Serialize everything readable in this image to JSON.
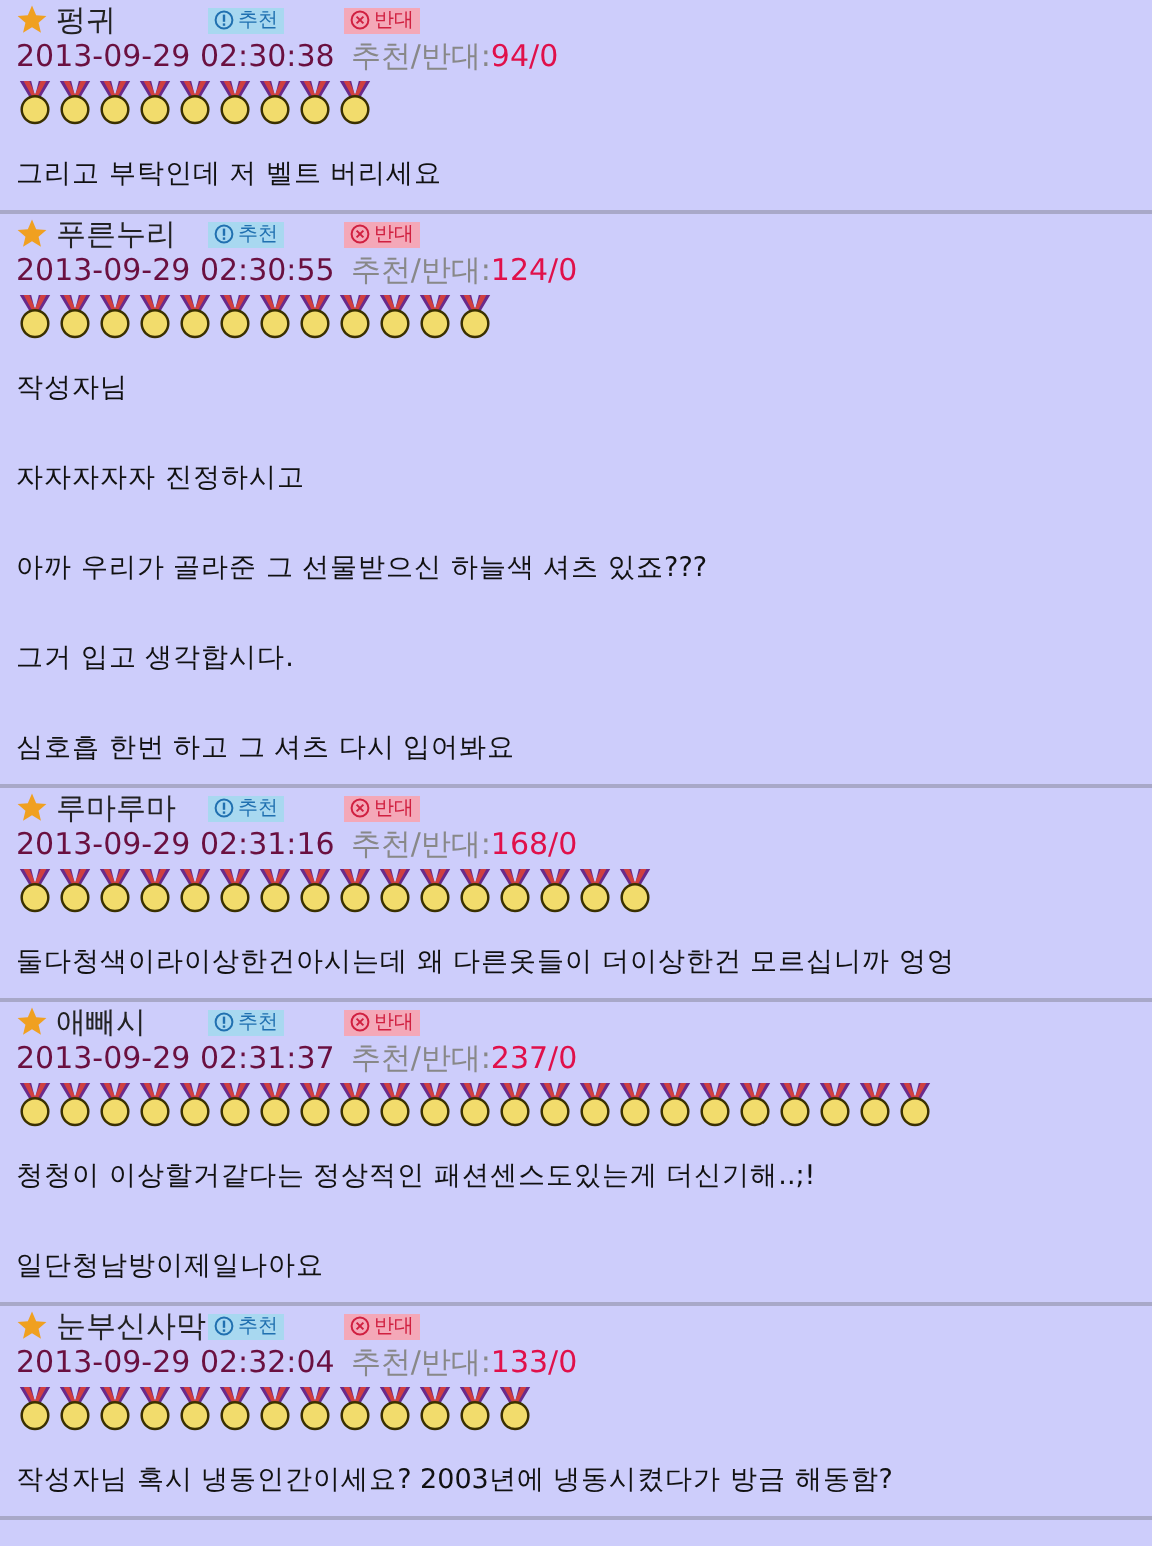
{
  "comments": [
    {
      "author": "펑귀",
      "recommend_label": "추천",
      "oppose_label": "반대",
      "datetime": "2013-09-29 02:30:38",
      "votes_label": "추천/반대:",
      "votes": "94/0",
      "medals": [
        {
          "kind": "medal"
        },
        {
          "kind": "medal"
        },
        {
          "kind": "medal"
        },
        {
          "kind": "medal"
        },
        {
          "kind": "medal"
        },
        {
          "kind": "medal"
        },
        {
          "kind": "medal"
        },
        {
          "kind": "medal"
        },
        {
          "kind": "medal"
        }
      ],
      "paragraphs": [
        "그리고 부탁인데 저 벨트 버리세요"
      ]
    },
    {
      "author": "푸른누리",
      "recommend_label": "추천",
      "oppose_label": "반대",
      "datetime": "2013-09-29 02:30:55",
      "votes_label": "추천/반대:",
      "votes": "124/0",
      "medals": [
        {
          "kind": "medal"
        },
        {
          "kind": "medal"
        },
        {
          "kind": "medal"
        },
        {
          "kind": "medal"
        },
        {
          "kind": "medal"
        },
        {
          "kind": "medal"
        },
        {
          "kind": "medal"
        },
        {
          "kind": "medal"
        },
        {
          "kind": "medal"
        },
        {
          "kind": "medal"
        },
        {
          "kind": "medal"
        },
        {
          "kind": "medal"
        }
      ],
      "paragraphs": [
        "작성자님",
        "자자자자자 진정하시고",
        "아까 우리가 골라준 그 선물받으신 하늘색 셔츠 있죠???",
        "그거 입고 생각합시다.",
        "심호흡 한번 하고 그 셔츠 다시 입어봐요"
      ]
    },
    {
      "author": "루마루마",
      "recommend_label": "추천",
      "oppose_label": "반대",
      "datetime": "2013-09-29 02:31:16",
      "votes_label": "추천/반대:",
      "votes": "168/0",
      "medals": [
        {
          "kind": "medal"
        },
        {
          "kind": "medal"
        },
        {
          "kind": "medal"
        },
        {
          "kind": "medal"
        },
        {
          "kind": "medal"
        },
        {
          "kind": "medal"
        },
        {
          "kind": "medal"
        },
        {
          "kind": "medal"
        },
        {
          "kind": "medal"
        },
        {
          "kind": "medal"
        },
        {
          "kind": "medal"
        },
        {
          "kind": "medal"
        },
        {
          "kind": "medal"
        },
        {
          "kind": "medal"
        },
        {
          "kind": "medal"
        },
        {
          "kind": "medal"
        }
      ],
      "paragraphs": [
        "둘다청색이라이상한건아시는데 왜 다른옷들이 더이상한건 모르십니까  엉엉"
      ]
    },
    {
      "author": "애빼시",
      "recommend_label": "추천",
      "oppose_label": "반대",
      "datetime": "2013-09-29 02:31:37",
      "votes_label": "추천/반대:",
      "votes": "237/0",
      "medals": [
        {
          "kind": "medal"
        },
        {
          "kind": "medal"
        },
        {
          "kind": "medal"
        },
        {
          "kind": "medal"
        },
        {
          "kind": "medal"
        },
        {
          "kind": "medal"
        },
        {
          "kind": "medal"
        },
        {
          "kind": "medal"
        },
        {
          "kind": "medal"
        },
        {
          "kind": "medal"
        },
        {
          "kind": "medal"
        },
        {
          "kind": "medal"
        },
        {
          "kind": "medal"
        },
        {
          "kind": "medal"
        },
        {
          "kind": "medal"
        },
        {
          "kind": "medal"
        },
        {
          "kind": "medal"
        },
        {
          "kind": "medal"
        },
        {
          "kind": "medal"
        },
        {
          "kind": "medal"
        },
        {
          "kind": "medal"
        },
        {
          "kind": "medal"
        },
        {
          "kind": "medal"
        }
      ],
      "paragraphs": [
        "청청이 이상할거같다는 정상적인 패션센스도있는게 더신기해..;!",
        "일단청남방이제일나아요"
      ]
    },
    {
      "author": "눈부신사막",
      "recommend_label": "추천",
      "oppose_label": "반대",
      "datetime": "2013-09-29 02:32:04",
      "votes_label": "추천/반대:",
      "votes": "133/0",
      "medals": [
        {
          "kind": "medal"
        },
        {
          "kind": "medal"
        },
        {
          "kind": "medal"
        },
        {
          "kind": "medal"
        },
        {
          "kind": "medal"
        },
        {
          "kind": "medal"
        },
        {
          "kind": "medal"
        },
        {
          "kind": "medal"
        },
        {
          "kind": "medal"
        },
        {
          "kind": "medal"
        },
        {
          "kind": "medal"
        },
        {
          "kind": "medal"
        },
        {
          "kind": "medal"
        }
      ],
      "paragraphs": [
        "작성자님 혹시 냉동인간이세요? 2003년에 냉동시켰다가 방금 해동함?"
      ]
    }
  ]
}
